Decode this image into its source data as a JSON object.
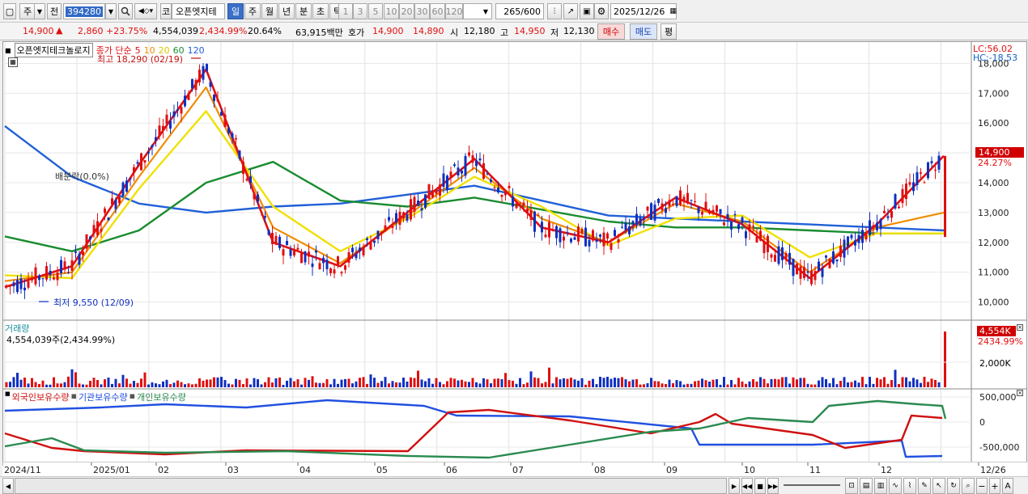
{
  "toolbar": {
    "market_button": "주",
    "type_button": "전",
    "code_value": "394280",
    "stock_name": "오픈엣지테",
    "stock_prefix": "코",
    "periods": [
      "일",
      "주",
      "월",
      "년",
      "분",
      "초",
      "틱"
    ],
    "selected_period": "일",
    "intervals": [
      "1",
      "3",
      "5",
      "10",
      "20",
      "30",
      "60",
      "120"
    ],
    "count_value": "265",
    "count_total": "/600",
    "date_value": "2025/12/26"
  },
  "quote": {
    "price": "14,900",
    "change": "2,860",
    "change_pct": "+23.75%",
    "volume": "4,554,039",
    "volume_pct": "2,434.99%",
    "turnover_rate": "20.64%",
    "amount": "63,915백만",
    "bid_label": "호가",
    "bid1": "14,900",
    "bid2": "14,890",
    "open_label": "시",
    "open": "12,180",
    "high_label": "고",
    "high": "14,950",
    "low_label": "저",
    "low": "12,130",
    "buy_button": "매수",
    "sell_button": "매도",
    "eval_button": "평"
  },
  "legend": {
    "name": "오픈엣지테크놀로지",
    "close_label": "종가 단순",
    "ma_periods": [
      "5",
      "10",
      "20",
      "60",
      "120"
    ],
    "high_note": "최고 18,290 (02/19)",
    "low_note": "최저 9,550 (12/09)",
    "ratio_note": "배분락(0.0%)",
    "lc": "LC:56.02",
    "hc": "HC:-18.53",
    "price_tag": "14,900",
    "price_tag_pct": "24.27%"
  },
  "volume_panel": {
    "title": "거래량",
    "value": "4,554,039주(2,434.99%)",
    "tag": "4,554K",
    "tag_pct": "2434.99%",
    "axis_label": "2,000K"
  },
  "holding_panel": {
    "foreign": "외국인보유수량",
    "institution": "기관보유수량",
    "individual": "개인보유수량",
    "axis": [
      "500,000",
      "0",
      "-500,000"
    ]
  },
  "price_axis": [
    "18,000",
    "17,000",
    "16,000",
    "15,000",
    "14,000",
    "13,000",
    "12,000",
    "11,000",
    "10,000"
  ],
  "x_axis": [
    "2024/11",
    "2025/01",
    "02",
    "03",
    "04",
    "05",
    "06",
    "07",
    "08",
    "09",
    "10",
    "11",
    "12",
    "12/26"
  ],
  "colors": {
    "ma5": "#e01010",
    "ma10": "#f08c00",
    "ma20": "#f0e000",
    "ma60": "#1a8c30",
    "ma120": "#2060d8",
    "up": "#e01010",
    "down": "#1030c0",
    "foreign": "#d01010",
    "institution": "#2050e0",
    "individual": "#2a8a50"
  },
  "chart_data": {
    "type": "line",
    "title": "오픈엣지테크놀로지",
    "x": [
      "2024/11",
      "2025/01",
      "02",
      "03",
      "04",
      "05",
      "06",
      "07",
      "08",
      "09",
      "10",
      "11",
      "12",
      "12/26"
    ],
    "ylim": [
      9500,
      18500
    ],
    "series": [
      {
        "name": "5",
        "values": [
          10500,
          11200,
          14600,
          17800,
          12000,
          11200,
          13000,
          14800,
          12500,
          12000,
          13500,
          12600,
          10800,
          12600,
          14900
        ]
      },
      {
        "name": "10",
        "values": [
          10700,
          11000,
          14200,
          17200,
          12500,
          11300,
          12900,
          14500,
          12800,
          12000,
          13300,
          12700,
          11000,
          12500,
          13000
        ]
      },
      {
        "name": "20",
        "values": [
          10900,
          10800,
          13800,
          16400,
          13200,
          11700,
          12800,
          14200,
          13200,
          11900,
          12800,
          12900,
          11500,
          12300,
          12300
        ]
      },
      {
        "name": "60",
        "values": [
          12200,
          11700,
          12400,
          14000,
          14700,
          13400,
          13200,
          13500,
          13100,
          12700,
          12500,
          12500,
          12400,
          12300,
          12300
        ]
      },
      {
        "name": "120",
        "values": [
          15900,
          14200,
          13300,
          13000,
          13200,
          13300,
          13600,
          13900,
          13400,
          12900,
          12800,
          12700,
          12600,
          12500,
          12400
        ]
      }
    ]
  }
}
